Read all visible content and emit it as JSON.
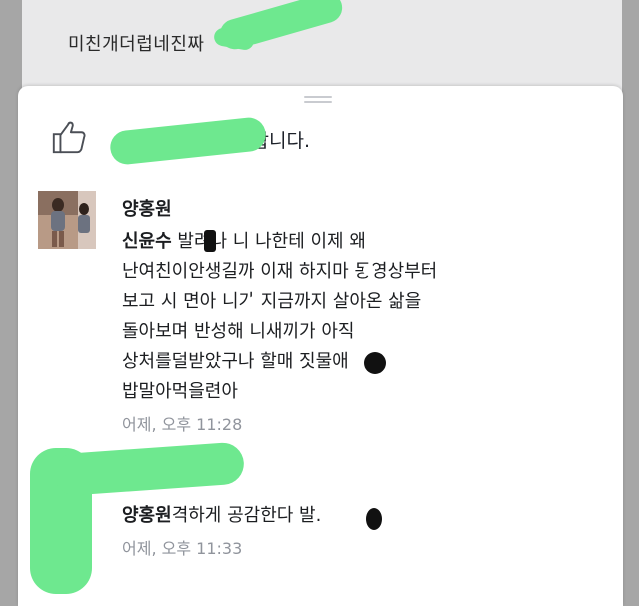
{
  "background": {
    "text": "미친개더럽네진짜"
  },
  "likes": {
    "icon": "thumbs-up-icon",
    "text": "이..님이 좋아합니다."
  },
  "comments": [
    {
      "author": "양홍원",
      "mention": "신윤수",
      "text": " 발려나 니 나한테 이제 왜\n난여친이안생길까 이재 하지마 동영상부터\n보고 시 면아 니가 지금까지 살아온 삶을\n돌아보며 반성해 니새끼가 아직\n상처를덜받았구나 할매 짓물애\n밥말아먹을련아",
      "time": "어제, 오후 11:28"
    },
    {
      "author": "양홍원",
      "text": "격하게 공감한다 발.",
      "time": "어제, 오후 11:33"
    }
  ],
  "colors": {
    "highlight": "#6ee88f",
    "sheet": "#ffffff",
    "backdrop": "#a6a6a6",
    "secondary_text": "#90949c"
  }
}
